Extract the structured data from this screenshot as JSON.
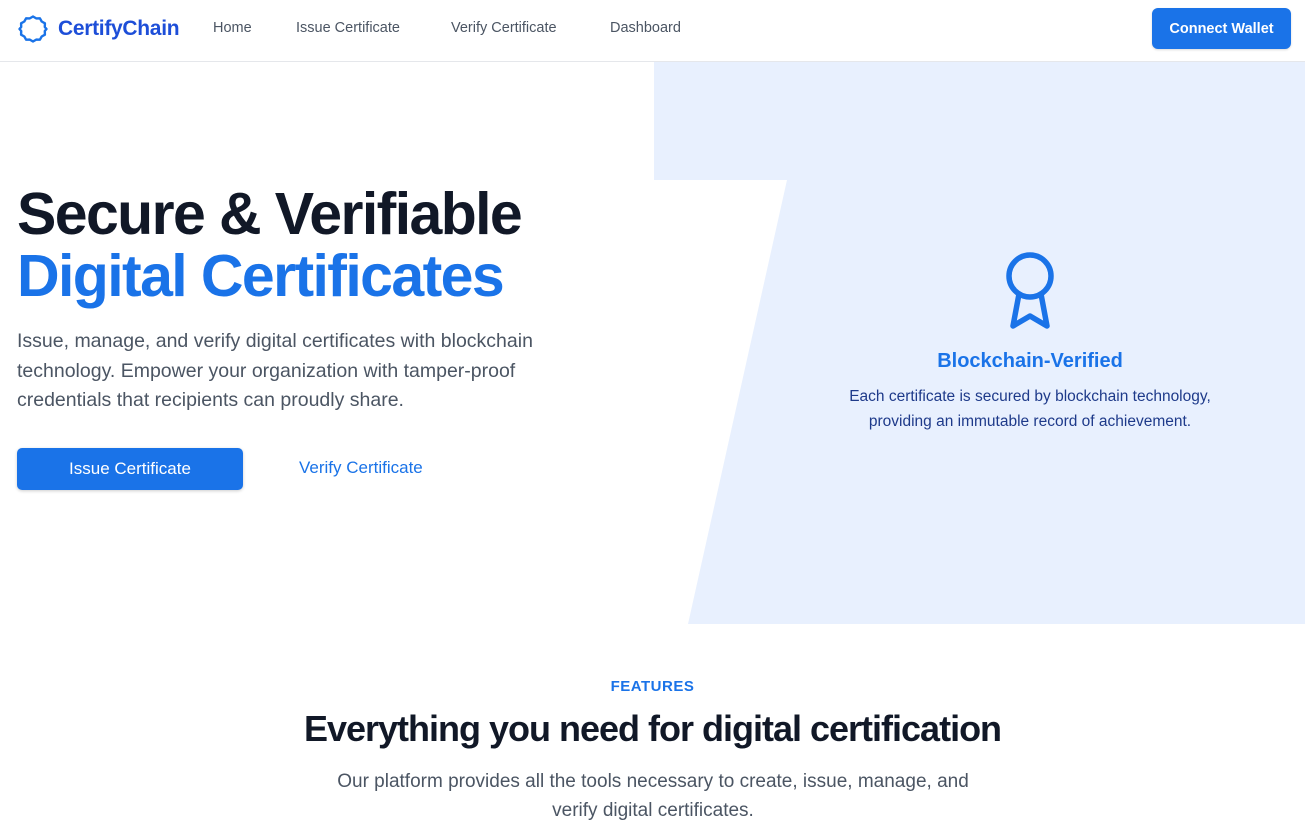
{
  "brand": {
    "name": "CertifyChain",
    "logo_icon": "certify-badge-icon",
    "accent": "#1a73e8",
    "panel_bg": "#e8f0fe"
  },
  "nav": {
    "links": [
      {
        "label": "Home"
      },
      {
        "label": "Issue Certificate"
      },
      {
        "label": "Verify Certificate"
      },
      {
        "label": "Dashboard"
      }
    ],
    "connect_wallet_label": "Connect Wallet"
  },
  "hero": {
    "title_line1": "Secure & Verifiable",
    "title_line2": "Digital Certificates",
    "description": "Issue, manage, and verify digital certificates with blockchain technology. Empower your organization with tamper-proof credentials that recipients can proudly share.",
    "primary_button": "Issue Certificate",
    "secondary_link": "Verify Certificate"
  },
  "highlight": {
    "icon": "award-ribbon-icon",
    "title": "Blockchain-Verified",
    "text_line1": "Each certificate is secured by blockchain technology,",
    "text_line2": "providing an immutable record of achievement."
  },
  "features": {
    "label": "FEATURES",
    "title": "Everything you need for digital certification",
    "description_line1": "Our platform provides all the tools necessary to create, issue, manage, and",
    "description_line2": "verify digital certificates."
  }
}
